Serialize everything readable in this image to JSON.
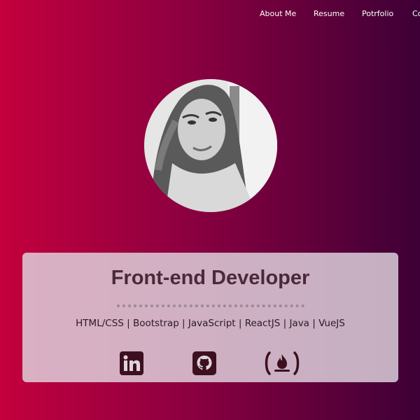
{
  "nav": {
    "items": [
      "About Me",
      "Resume",
      "Potrfolio",
      "Co"
    ]
  },
  "profile": {
    "avatar_alt": "profile photo"
  },
  "card": {
    "title": "Front-end Developer",
    "skills": "HTML/CSS | Bootstrap | JavaScript | ReactJS | Java | VueJS",
    "social": [
      "linkedin-icon",
      "github-icon",
      "freecodecamp-icon"
    ]
  },
  "colors": {
    "gradient_start": "#c4003d",
    "gradient_end": "#3d0036",
    "card_text": "#4a2a3a"
  }
}
